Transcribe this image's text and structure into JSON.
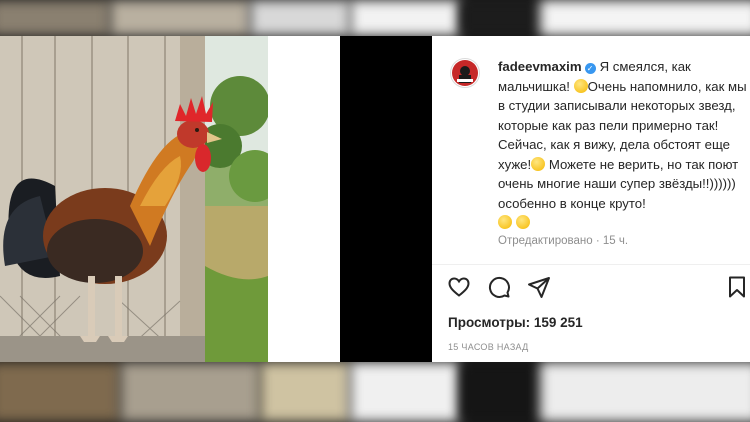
{
  "post": {
    "username": "fadeevmaxim",
    "caption_parts": [
      "Я смеялся, как мальчишка! ",
      "Очень напомнило, как мы в студии записывали некоторых звезд, которые как раз пели примерно так! Сейчас, как я вижу, дела обстоят еще хуже!",
      " Можете не верить, но так поют очень многие наши супер звёзды!!)))))) особенно в конце круто!"
    ],
    "edited_label": "Отредактировано · 15 ч.",
    "views_label": "Просмотры: 159 251",
    "time_ago": "15 ЧАСОВ НАЗАД"
  },
  "icons": {
    "like": "heart-icon",
    "comment": "comment-icon",
    "share": "send-icon",
    "save": "bookmark-icon",
    "verified": "verified-badge-icon"
  },
  "colors": {
    "verified_blue": "#3897f0",
    "text": "#262626",
    "muted": "#8e8e8e"
  }
}
